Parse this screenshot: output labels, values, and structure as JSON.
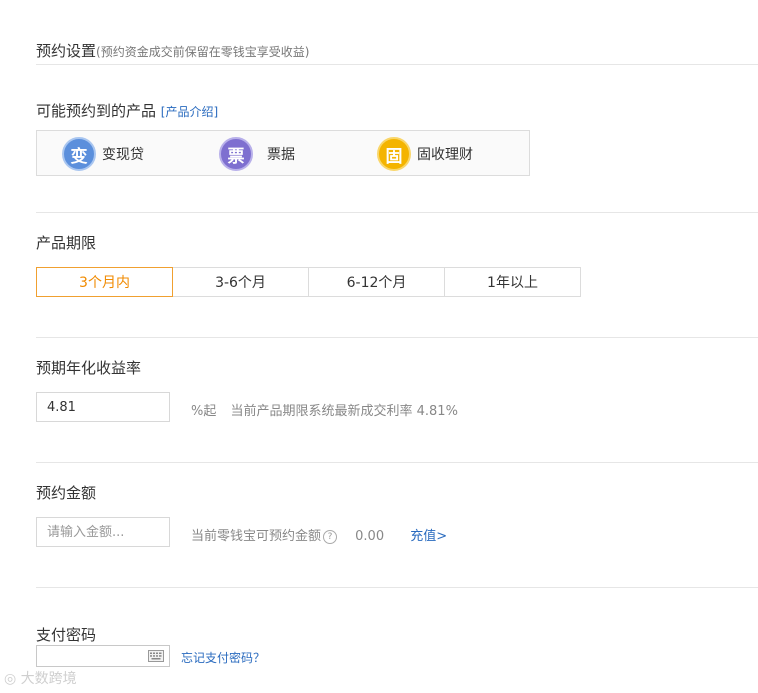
{
  "header": {
    "title": "预约设置",
    "subtitle": "(预约资金成交前保留在零钱宝享受收益)"
  },
  "products": {
    "label": "可能预约到的产品",
    "intro_link": "[产品介绍]",
    "items": [
      {
        "badge": "变",
        "name": "变现贷",
        "color": "#5b8fdc"
      },
      {
        "badge": "票",
        "name": "票据",
        "color": "#7e6fd0"
      },
      {
        "badge": "固",
        "name": "固收理财",
        "color": "#f4b400"
      }
    ]
  },
  "period": {
    "label": "产品期限",
    "options": [
      "3个月内",
      "3-6个月",
      "6-12个月",
      "1年以上"
    ],
    "selected": "3个月内",
    "accent": "#f08a00"
  },
  "rate": {
    "label": "预期年化收益率",
    "value": "4.81",
    "unit": "%起",
    "hint": "当前产品期限系统最新成交利率 4.81%"
  },
  "amount": {
    "label": "预约金额",
    "placeholder": "请输入金额...",
    "hint": "当前零钱宝可预约金额",
    "help": "?",
    "available": "0.00",
    "recharge_link": "充值>"
  },
  "password": {
    "label": "支付密码",
    "forgot_link": "忘记支付密码？"
  },
  "watermark": "大数跨境"
}
